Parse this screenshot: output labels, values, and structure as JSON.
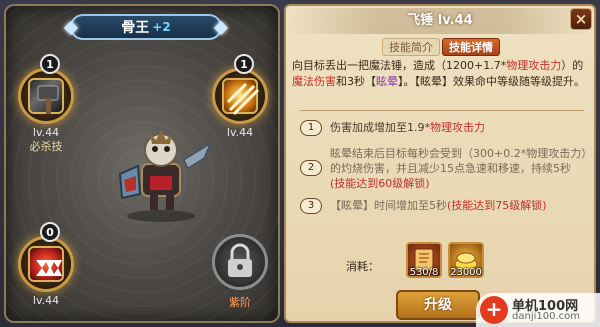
{
  "hero": {
    "name": "骨王",
    "plus": "+2"
  },
  "skills": [
    {
      "badge": "1",
      "level": "lv.44",
      "tag": "必杀技",
      "icon": "hammer-icon"
    },
    {
      "badge": "1",
      "level": "lv.44",
      "tag": "",
      "icon": "slash-icon"
    },
    {
      "badge": "0",
      "level": "lv.44",
      "tag": "",
      "icon": "fangs-icon"
    },
    {
      "badge": "",
      "level": "",
      "tag": "紫阶",
      "icon": "lock-icon"
    }
  ],
  "detail": {
    "title": "飞锤  lv.44",
    "tabs": [
      "技能简介",
      "技能详情"
    ],
    "desc_parts": [
      "向目标丢出一把魔法锤，造成（1200+1.7*",
      "物理攻击力",
      "）的",
      "魔法伤害",
      "和3秒【",
      "眩晕",
      "】。【眩晕】效果命中等级随等级提升。"
    ],
    "bonuses": [
      {
        "num": "1",
        "text_a": "伤害加成增加至1.9*",
        "text_b": "物理攻击力",
        "text_c": ""
      },
      {
        "num": "2",
        "text_a": "眩晕结束后目标每秒会受到（300+0.2*物理攻击力）的灼烧伤害，并且减少15点急速和移速，持续5秒",
        "text_b": "",
        "text_c": "(技能达到60级解锁)"
      },
      {
        "num": "3",
        "text_a": "【眩晕】时间增加至5秒",
        "text_b": "",
        "text_c": "(技能达到75级解锁)"
      }
    ],
    "cost_label": "消耗：",
    "costs": [
      {
        "count": "530/8",
        "icon": "skill-book-icon"
      },
      {
        "count": "23000",
        "icon": "gold-icon"
      }
    ],
    "upgrade_label": "升级",
    "close_icon": "×"
  },
  "watermark": {
    "title": "单机100网",
    "url": "danji100.com"
  },
  "colors": {
    "accent": "#d76a2a",
    "frame": "#c99a43",
    "highlight_red": "#c0302a"
  }
}
